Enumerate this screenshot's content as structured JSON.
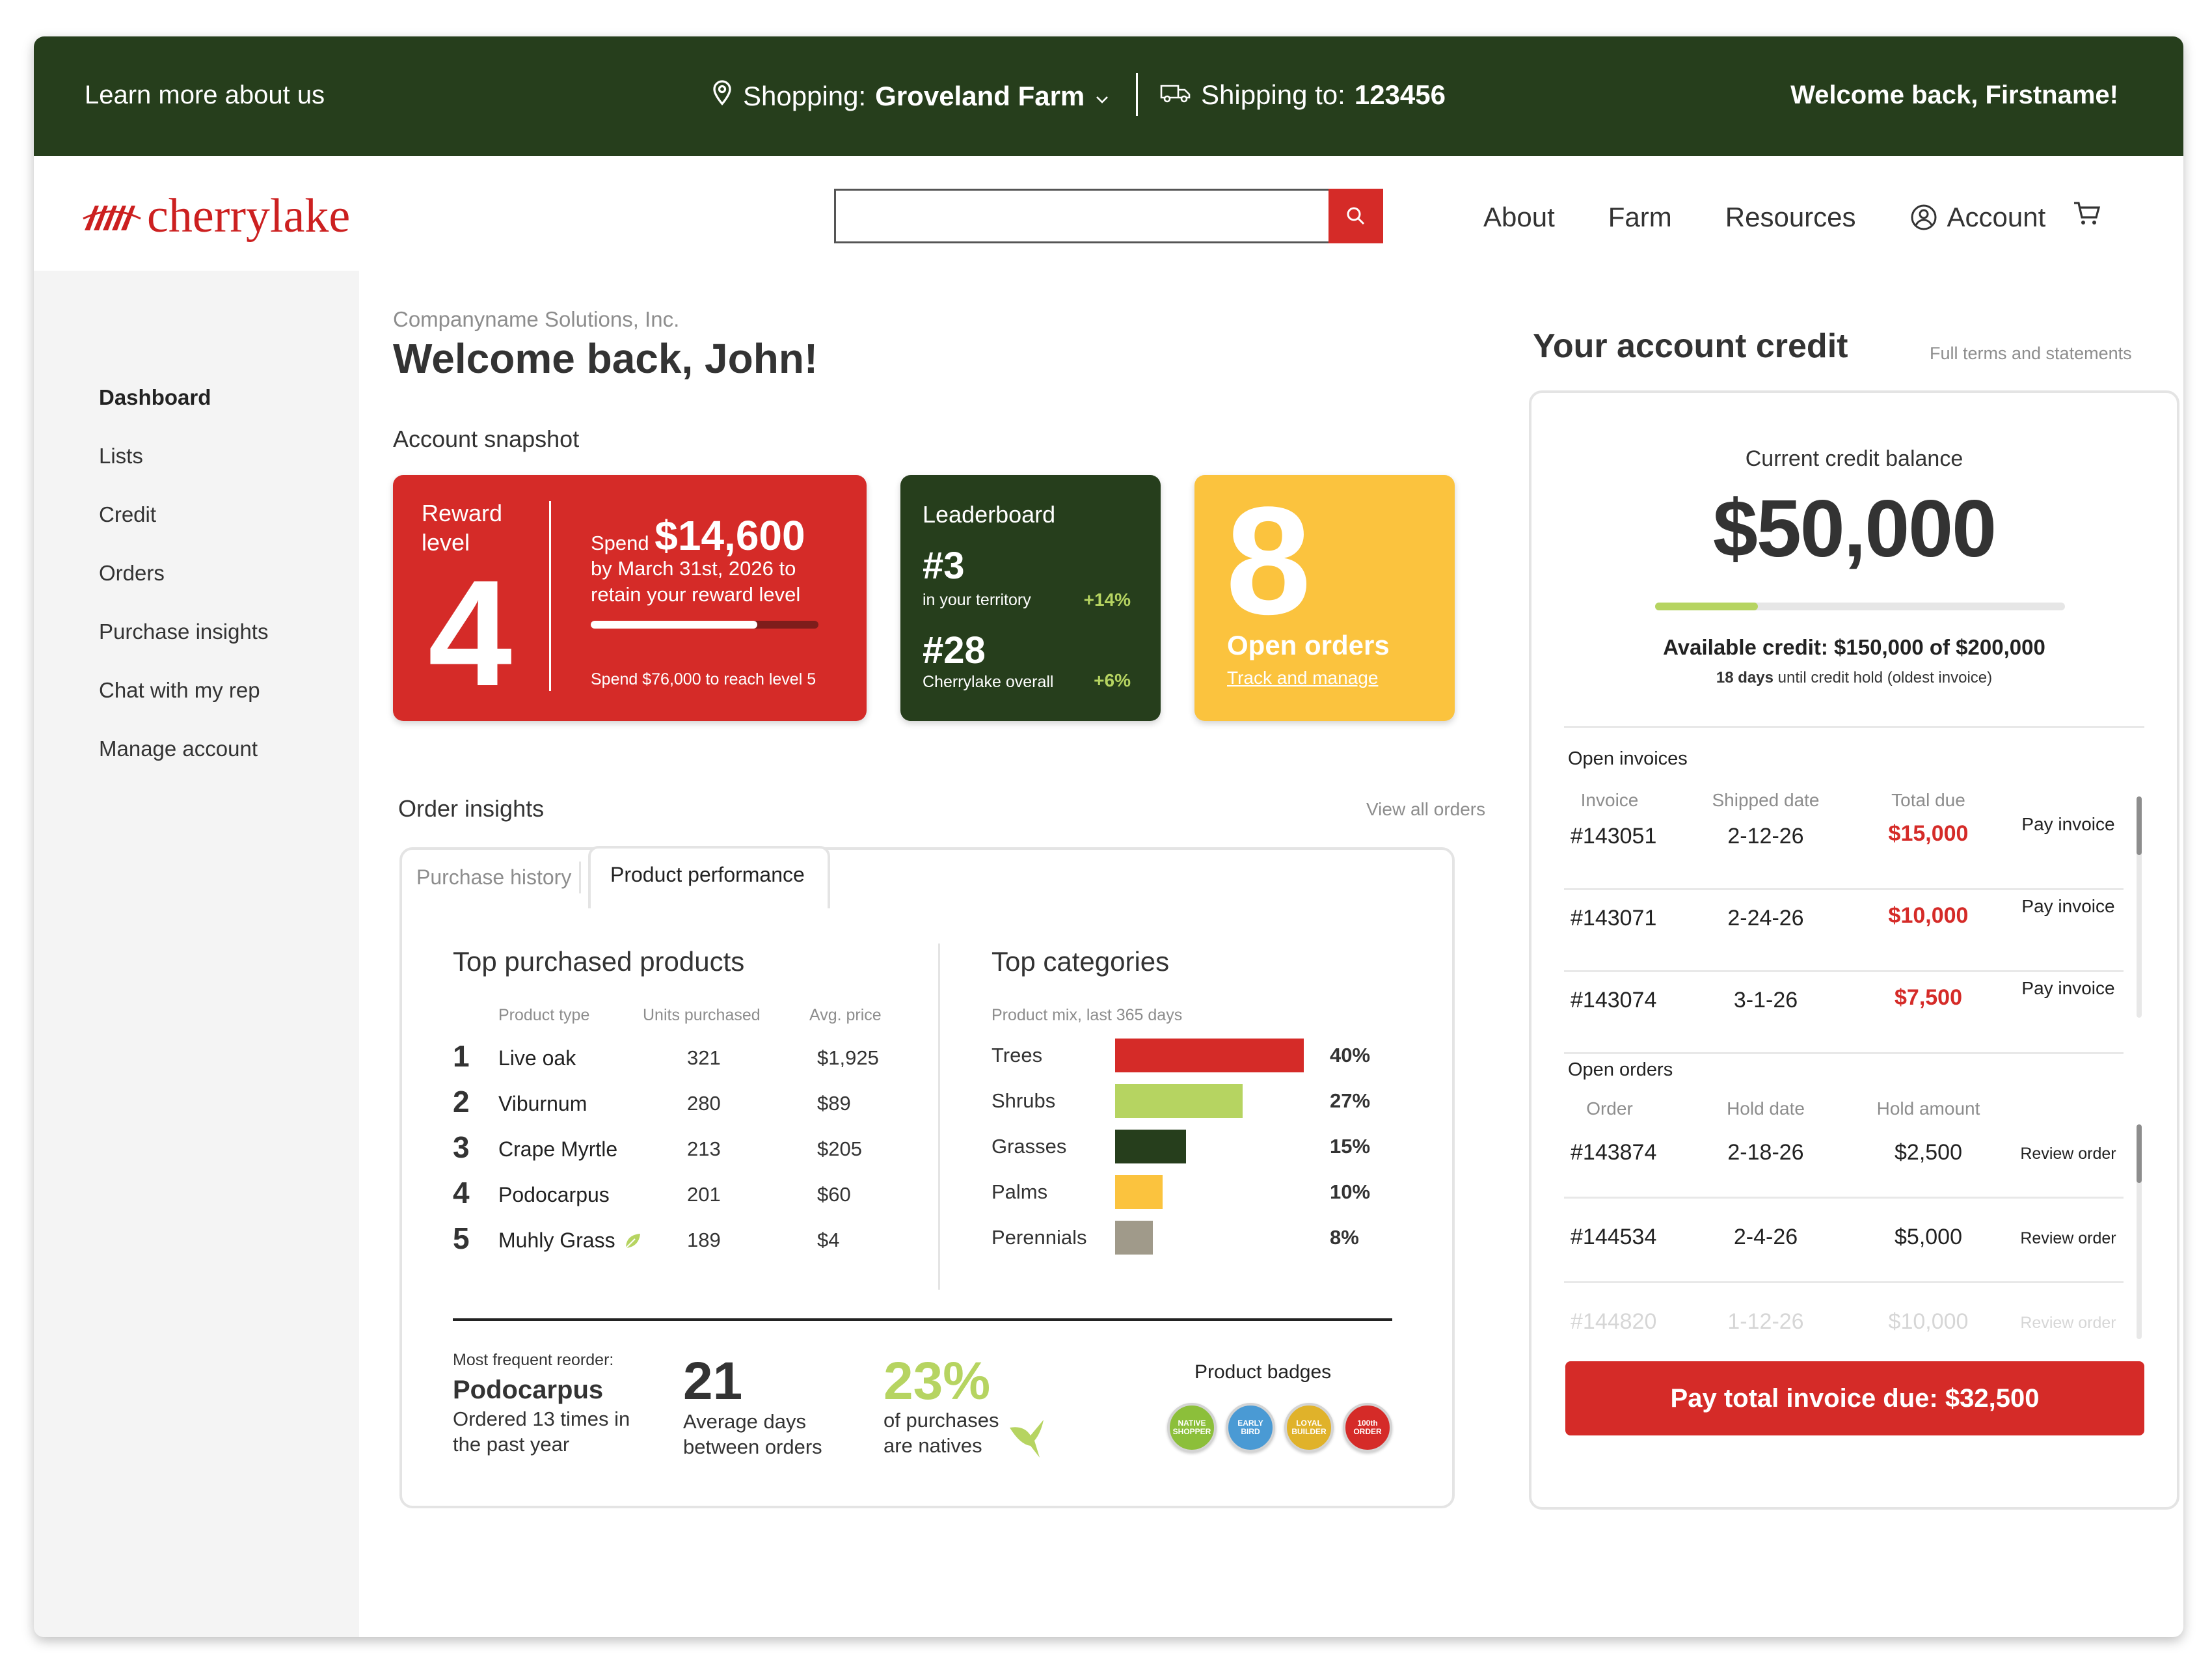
{
  "topbar": {
    "learn": "Learn more about us",
    "shopping_label": "Shopping:",
    "shopping_farm": "Groveland Farm",
    "shipping_label": "Shipping to:",
    "shipping_zip": "123456",
    "welcome": "Welcome back, Firstname!"
  },
  "header": {
    "logo_text": "cherrylake",
    "search_placeholder": "",
    "nav": [
      "About",
      "Farm",
      "Resources",
      "Account"
    ]
  },
  "sidebar": {
    "items": [
      "Dashboard",
      "Lists",
      "Credit",
      "Orders",
      "Purchase insights",
      "Chat with my rep",
      "Manage account"
    ],
    "active": "Dashboard"
  },
  "main": {
    "company": "Companyname Solutions, Inc.",
    "greeting": "Welcome back, John!",
    "snapshot_title": "Account snapshot",
    "reward": {
      "label": "Reward level",
      "level": "4",
      "spend_prefix": "Spend",
      "spend_amount": "$14,600",
      "by_text": "by March 31st, 2026 to retain your reward level",
      "progress": 0.73,
      "next_text": "Spend $76,000 to reach level 5"
    },
    "leaderboard": {
      "title": "Leaderboard",
      "territory_rank": "#3",
      "territory_label": "in your territory",
      "territory_delta": "+14%",
      "overall_rank": "#28",
      "overall_label": "Cherrylake overall",
      "overall_delta": "+6%"
    },
    "open_orders": {
      "count": "8",
      "label": "Open orders",
      "link": "Track and manage"
    },
    "order_insights": {
      "title": "Order insights",
      "view_all": "View all orders",
      "tabs": [
        "Purchase history",
        "Product performance"
      ],
      "active_tab": "Product performance"
    },
    "top_products": {
      "title": "Top purchased products",
      "headers": [
        "Product type",
        "Units purchased",
        "Avg. price"
      ],
      "rows": [
        {
          "rank": "1",
          "name": "Live oak",
          "units": "321",
          "price": "$1,925",
          "native": false
        },
        {
          "rank": "2",
          "name": "Viburnum",
          "units": "280",
          "price": "$89",
          "native": false
        },
        {
          "rank": "3",
          "name": "Crape Myrtle",
          "units": "213",
          "price": "$205",
          "native": false
        },
        {
          "rank": "4",
          "name": "Podocarpus",
          "units": "201",
          "price": "$60",
          "native": false
        },
        {
          "rank": "5",
          "name": "Muhly Grass",
          "units": "189",
          "price": "$4",
          "native": true
        }
      ]
    },
    "top_categories": {
      "title": "Top categories",
      "subtitle": "Product mix, last 365 days",
      "rows": [
        {
          "name": "Trees",
          "pct": "40%",
          "value": 40,
          "color": "#d52b28"
        },
        {
          "name": "Shrubs",
          "pct": "27%",
          "value": 27,
          "color": "#b6d461"
        },
        {
          "name": "Grasses",
          "pct": "15%",
          "value": 15,
          "color": "#263e1c"
        },
        {
          "name": "Palms",
          "pct": "10%",
          "value": 10,
          "color": "#fbc33e"
        },
        {
          "name": "Perennials",
          "pct": "8%",
          "value": 8,
          "color": "#a09a8a"
        }
      ]
    },
    "reorder": {
      "label": "Most frequent reorder:",
      "name": "Podocarpus",
      "sub": "Ordered 13 times in the past year"
    },
    "avg_days": {
      "value": "21",
      "label": "Average days between orders"
    },
    "natives": {
      "value": "23%",
      "label": "of purchases are natives"
    },
    "badges": {
      "title": "Product badges",
      "items": [
        {
          "text": "NATIVE SHOPPER",
          "color": "#8cbf3a"
        },
        {
          "text": "EARLY BIRD",
          "color": "#4a9ad4"
        },
        {
          "text": "LOYAL BUILDER",
          "color": "#e0b22a"
        },
        {
          "text": "100th ORDER",
          "color": "#d52b28"
        }
      ]
    }
  },
  "credit": {
    "title": "Your account credit",
    "terms": "Full terms and statements",
    "balance_label": "Current credit balance",
    "balance": "$50,000",
    "used_fraction": 0.25,
    "available": "Available credit: $150,000 of $200,000",
    "hold_days": "18 days",
    "hold_text": "until credit hold (oldest invoice)",
    "open_invoices": {
      "title": "Open invoices",
      "headers": [
        "Invoice",
        "Shipped date",
        "Total due"
      ],
      "rows": [
        {
          "id": "#143051",
          "date": "2-12-26",
          "total": "$15,000",
          "action": "Pay invoice"
        },
        {
          "id": "#143071",
          "date": "2-24-26",
          "total": "$10,000",
          "action": "Pay invoice"
        },
        {
          "id": "#143074",
          "date": "3-1-26",
          "total": "$7,500",
          "action": "Pay invoice"
        }
      ]
    },
    "open_orders": {
      "title": "Open orders",
      "headers": [
        "Order",
        "Hold date",
        "Hold amount"
      ],
      "rows": [
        {
          "id": "#143874",
          "date": "2-18-26",
          "amount": "$2,500",
          "action": "Review order"
        },
        {
          "id": "#144534",
          "date": "2-4-26",
          "amount": "$5,000",
          "action": "Review order"
        },
        {
          "id": "#144820",
          "date": "1-12-26",
          "amount": "$10,000",
          "action": "Review order"
        }
      ]
    },
    "pay_button": "Pay total invoice due: $32,500"
  }
}
